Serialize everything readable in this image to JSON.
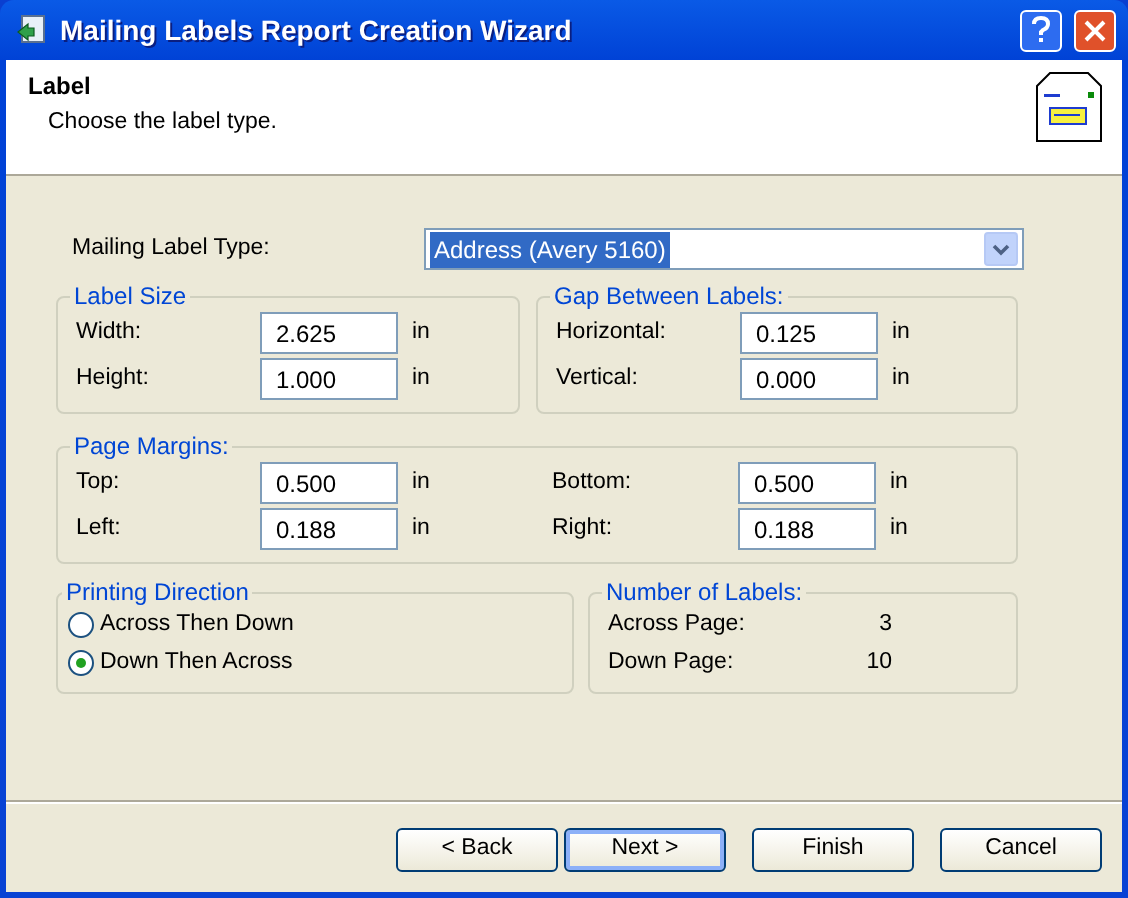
{
  "window": {
    "title": "Mailing Labels Report Creation Wizard"
  },
  "header": {
    "title": "Label",
    "subtitle": "Choose the label type."
  },
  "label_type": {
    "label": "Mailing Label Type:",
    "value": "Address (Avery 5160)"
  },
  "label_size": {
    "title": "Label Size",
    "rows": [
      [
        {
          "label": "Width:",
          "value": "2.625",
          "unit": "in"
        }
      ],
      [
        {
          "label": "Height:",
          "value": "1.000",
          "unit": "in"
        }
      ]
    ]
  },
  "gap_between_labels": {
    "title": "Gap Between Labels:",
    "rows": [
      [
        {
          "label": "Horizontal:",
          "value": "0.125",
          "unit": "in"
        }
      ],
      [
        {
          "label": "Vertical:",
          "value": "0.000",
          "unit": "in"
        }
      ]
    ]
  },
  "page_margins": {
    "title": "Page Margins:",
    "rows": [
      [
        {
          "label": "Top:",
          "value": "0.500",
          "unit": "in"
        },
        {
          "label": "Bottom:",
          "value": "0.500",
          "unit": "in"
        }
      ],
      [
        {
          "label": "Left:",
          "value": "0.188",
          "unit": "in"
        },
        {
          "label": "Right:",
          "value": "0.188",
          "unit": "in"
        }
      ]
    ]
  },
  "printing_direction": {
    "title": "Printing Direction",
    "options": [
      {
        "label": "Across Then Down",
        "selected": false
      },
      {
        "label": "Down Then Across",
        "selected": true
      }
    ]
  },
  "number_of_labels": {
    "title": "Number of Labels:",
    "rows": [
      {
        "label": "Across Page:",
        "value": "3"
      },
      {
        "label": "Down Page:",
        "value": "10"
      }
    ]
  },
  "buttons": [
    {
      "label": "< Back",
      "default": false
    },
    {
      "label": "Next >",
      "default": true
    },
    {
      "label": "Finish",
      "default": false
    },
    {
      "label": "Cancel",
      "default": false
    }
  ]
}
